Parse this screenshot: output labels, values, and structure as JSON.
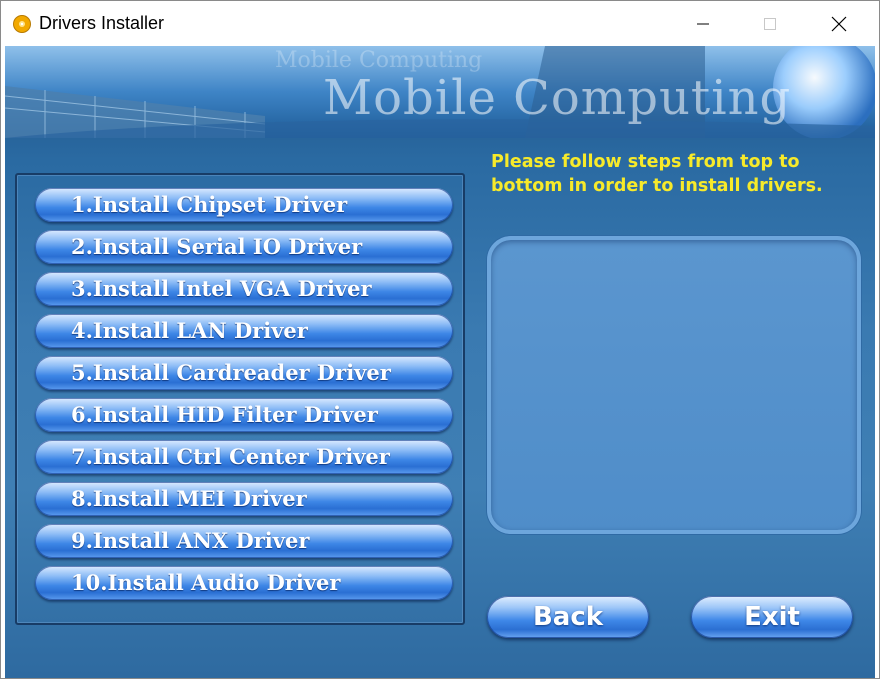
{
  "window": {
    "title": "Drivers Installer",
    "icon": "cd-disc-icon"
  },
  "banner": {
    "brand": "Mobile Computing",
    "brand_faint": "Mobile Computing"
  },
  "instruction": "Please follow steps from top to bottom in order to install drivers.",
  "install_buttons": [
    {
      "label": "1.Install Chipset Driver"
    },
    {
      "label": "2.Install Serial IO Driver"
    },
    {
      "label": "3.Install Intel VGA Driver"
    },
    {
      "label": "4.Install LAN Driver"
    },
    {
      "label": "5.Install Cardreader Driver"
    },
    {
      "label": "6.Install HID Filter Driver"
    },
    {
      "label": "7.Install Ctrl Center Driver"
    },
    {
      "label": "8.Install MEI Driver"
    },
    {
      "label": "9.Install ANX Driver"
    },
    {
      "label": "10.Install Audio Driver"
    }
  ],
  "actions": {
    "back_label": "Back",
    "exit_label": "Exit"
  },
  "colors": {
    "accent_text": "#f7ea2a",
    "background": "#3a7ab1",
    "button": "#3d86e6"
  }
}
